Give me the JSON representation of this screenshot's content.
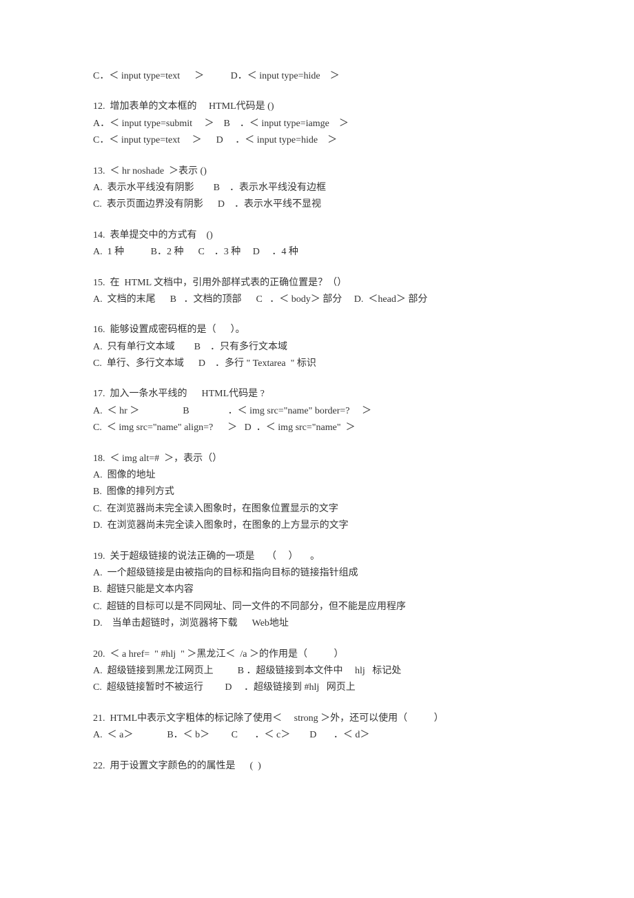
{
  "lines": [
    "C．＜ input type=text      ＞           D．＜ input type=hide    ＞",
    "",
    "12.  增加表单的文本框的     HTML代码是 ()",
    "A．＜ input type=submit     ＞    B    ．＜ input type=iamge    ＞",
    "C．＜ input type=text     ＞      D     ．＜ input type=hide    ＞",
    "",
    "13.  ＜ hr noshade  ＞表示 ()",
    "A.  表示水平线没有阴影        B    ．表示水平线没有边框",
    "C.  表示页面边界没有阴影      D    ．表示水平线不显视",
    "",
    "14.  表单提交中的方式有    ()",
    "A.  1 种           B．2 种      C    ．3 种     D     ．4 种",
    "",
    "15.  在  HTML 文档中，引用外部样式表的正确位置是？（）",
    "A.  文档的末尾      B   ．文档的顶部      C   ．＜ body＞ 部分     D.  ＜head＞ 部分",
    "",
    "16.  能够设置成密码框的是（      ）。",
    "A.  只有单行文本域        B    ．只有多行文本域",
    "C.  单行、多行文本域      D    ．多行 \" Textarea  \" 标识",
    "",
    "17.  加入一条水平线的      HTML代码是 ?",
    "A.  ＜ hr ＞                  B                ．＜ img src=\"name\" border=?     ＞",
    "C.  ＜ img src=\"name\" align=?      ＞   D  ．＜ img src=\"name\"  ＞",
    "",
    "18.  ＜ img alt=#  ＞，表示（）",
    "A.  图像的地址",
    "B.  图像的排列方式",
    "C.  在浏览器尚未完全读入图象时，在图象位置显示的文字",
    "D.  在浏览器尚未完全读入图象时，在图象的上方显示的文字",
    "",
    "19.  关于超级链接的说法正确的一项是     （     ）     。",
    "A.  一个超级链接是由被指向的目标和指向目标的链接指针组成",
    "B.  超链只能是文本内容",
    "C.  超链的目标可以是不同网址、同一文件的不同部分，但不能是应用程序",
    "D.    当单击超链时，浏览器将下载      Web地址",
    "",
    "20.  ＜ a href=  \" #hlj  \" ＞黑龙江＜  /a ＞的作用是（           ）",
    "A.  超级链接到黑龙江网页上          B ．超级链接到本文件中     hlj   标记处",
    "C.  超级链接暂时不被运行         D     ．超级链接到 #hlj   网页上",
    "",
    "21.  HTML中表示文字粗体的标记除了使用＜     strong ＞外，还可以使用（           ）",
    "A.  ＜ a＞              B．＜ b＞         C       ．＜ c＞        D       ．＜ d＞",
    "",
    "22.  用于设置文字颜色的的属性是      (  )"
  ]
}
